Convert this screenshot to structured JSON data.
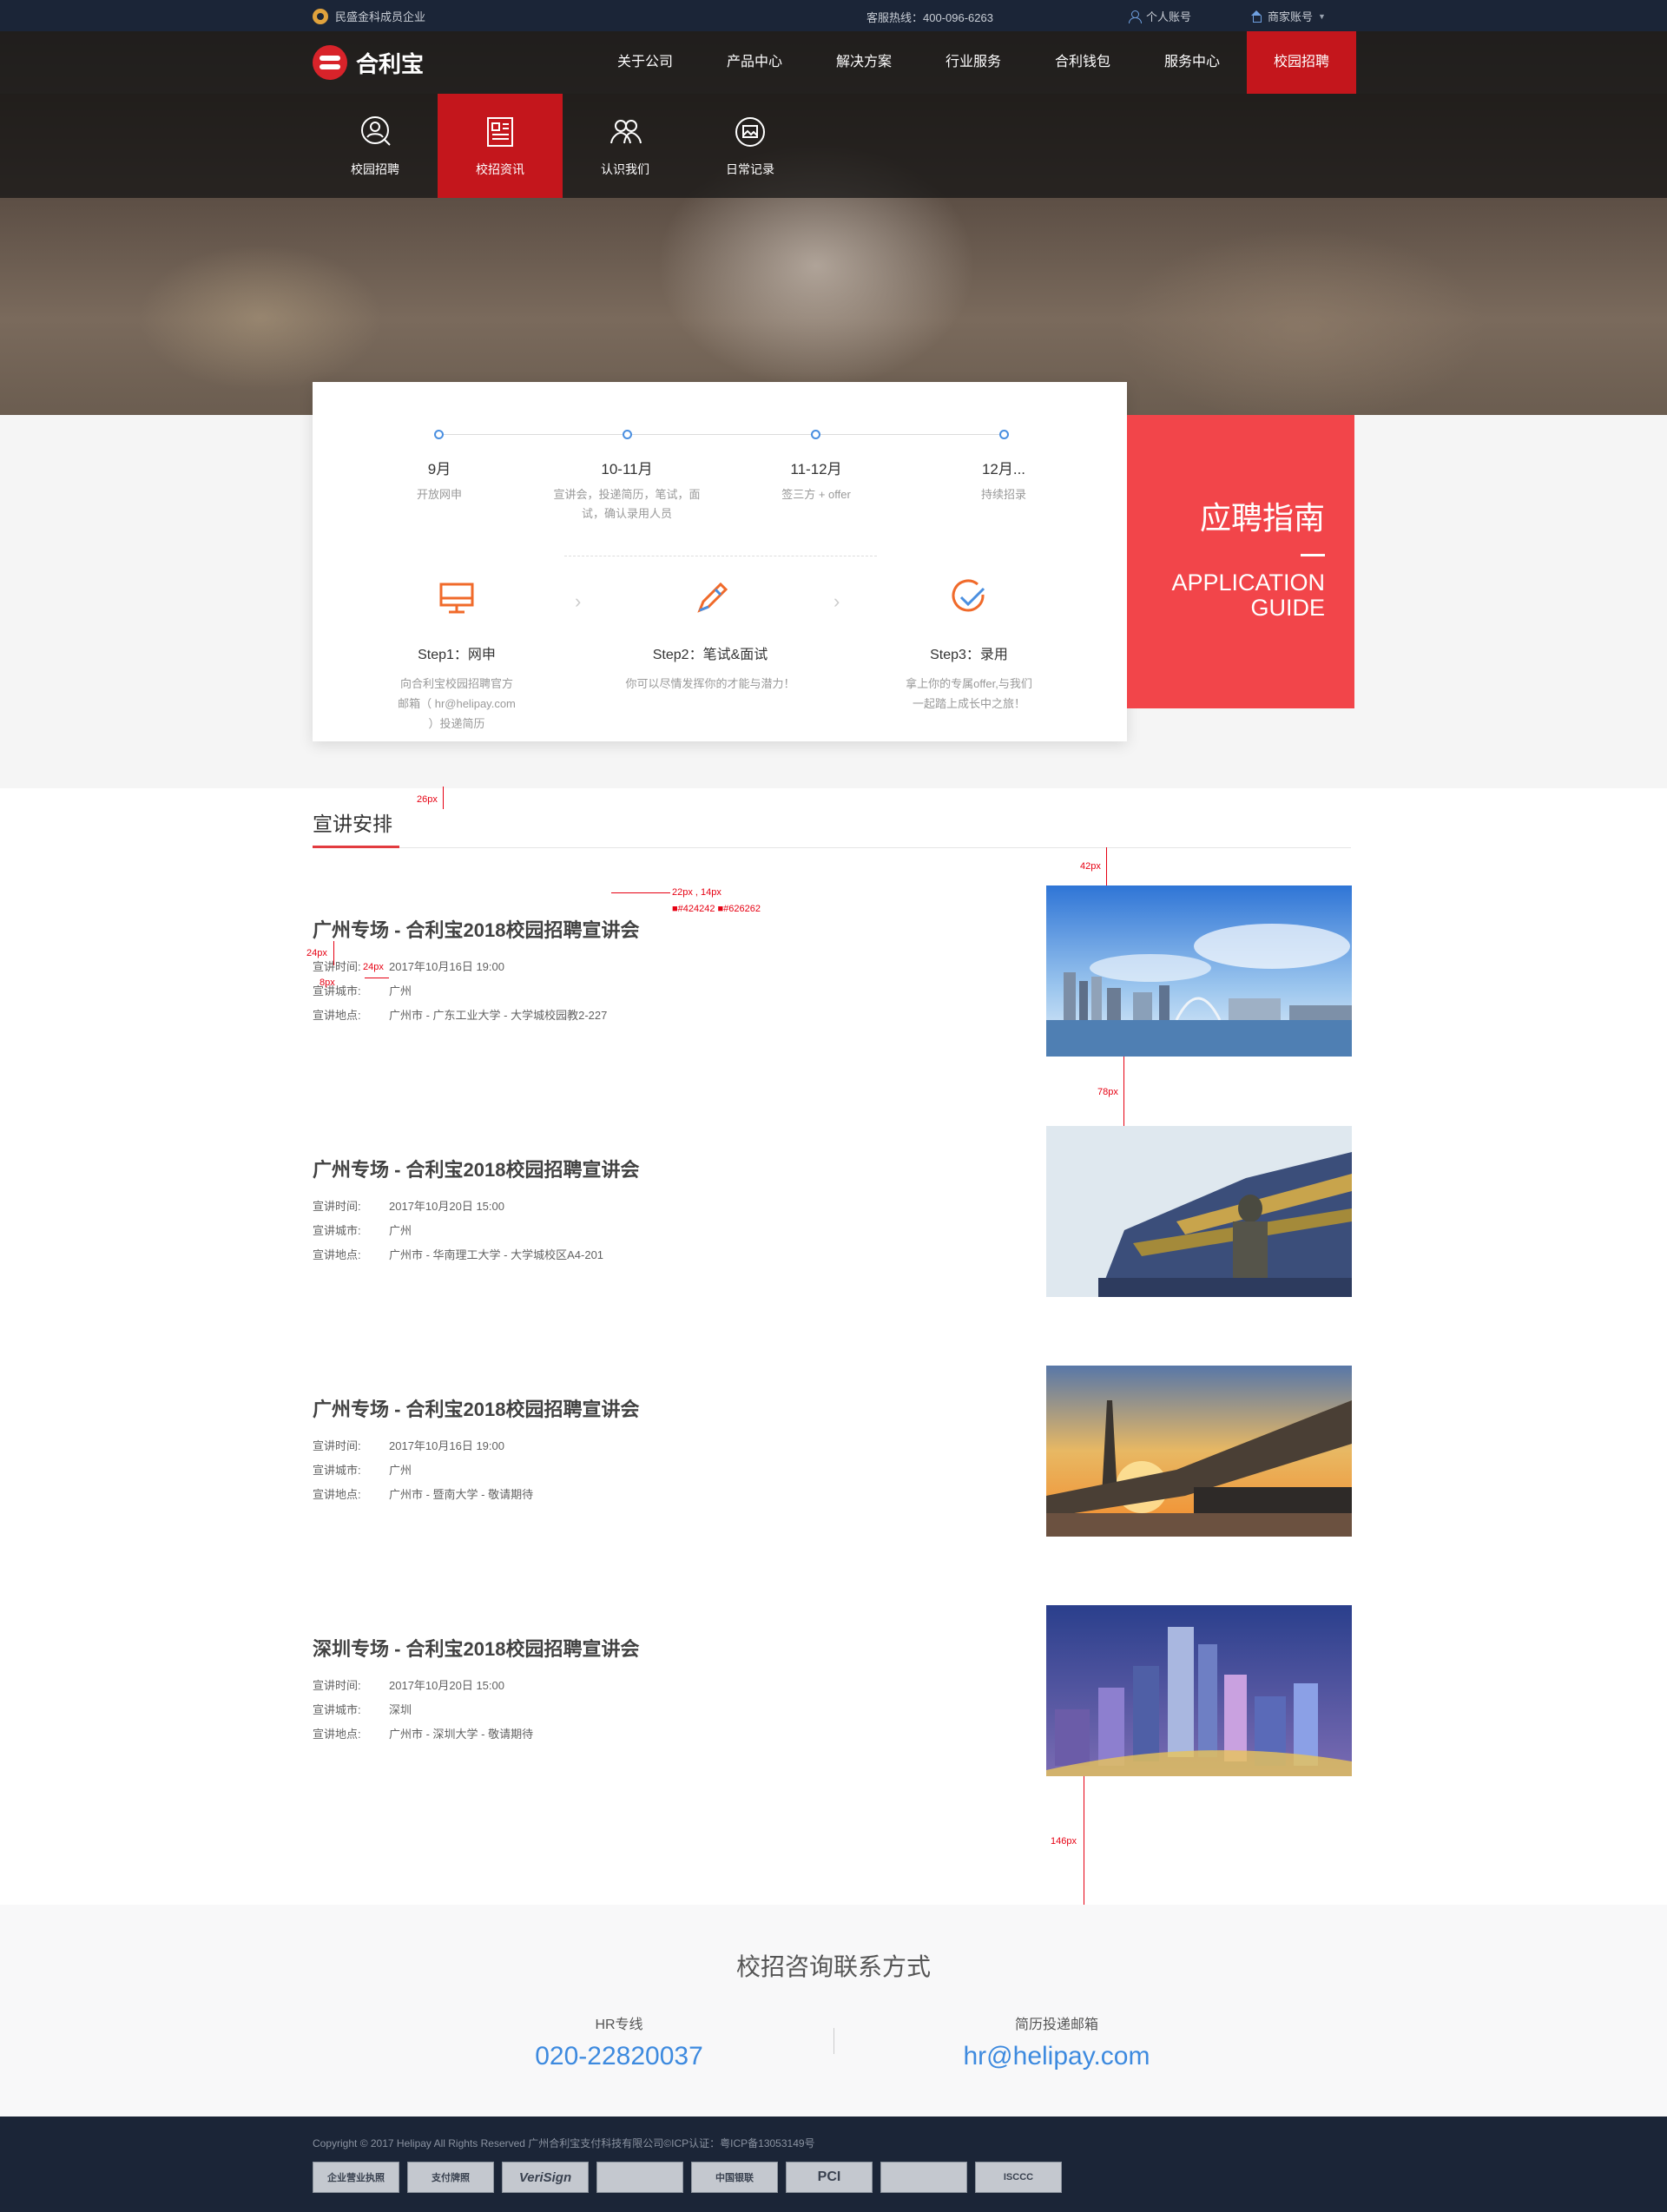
{
  "topbar": {
    "badge": "民盛金科成员企业",
    "hotline": "客服热线：400-096-6263",
    "user": "个人账号",
    "merchant": "商家账号"
  },
  "header": {
    "brand": "合利宝",
    "nav": [
      "关于公司",
      "产品中心",
      "解决方案",
      "行业服务",
      "合利钱包",
      "服务中心",
      "校园招聘"
    ],
    "active_nav": "校园招聘"
  },
  "subnav": {
    "items": [
      {
        "label": "校园招聘",
        "icon": "search-person-icon"
      },
      {
        "label": "校招资讯",
        "icon": "news-icon"
      },
      {
        "label": "认识我们",
        "icon": "group-icon"
      },
      {
        "label": "日常记录",
        "icon": "photo-icon"
      }
    ],
    "active": "校招资讯"
  },
  "timeline": [
    {
      "month": "9月",
      "desc": "开放网申"
    },
    {
      "month": "10-11月",
      "desc": "宣讲会，投递简历，笔试，面试，确认录用人员"
    },
    {
      "month": "11-12月",
      "desc": "签三方 + offer"
    },
    {
      "month": "12月...",
      "desc": "持续招录"
    }
  ],
  "steps": [
    {
      "title": "Step1：网申",
      "desc": "向合利宝校园招聘官方邮箱（ hr@helipay.com ）投递简历",
      "icon": "monitor-icon"
    },
    {
      "title": "Step2：笔试&面试",
      "desc": "你可以尽情发挥你的才能与潜力！",
      "icon": "pencil-icon"
    },
    {
      "title": "Step3：录用",
      "desc": "拿上你的专属offer,与我们一起踏上成长中之旅！",
      "icon": "check-circle-icon"
    }
  ],
  "guide": {
    "cn": "应聘指南",
    "en1": "APPLICATION",
    "en2": "GUIDE"
  },
  "section_title": "宣讲安排",
  "labels": {
    "time": "宣讲时间:",
    "city": "宣讲城市:",
    "place": "宣讲地点:"
  },
  "sessions": [
    {
      "title": "广州专场 - 合利宝2018校园招聘宣讲会",
      "time": "2017年10月16日  19:00",
      "city": "广州",
      "place": "广州市 - 广东工业大学 - 大学城校园教2-227"
    },
    {
      "title": "广州专场 - 合利宝2018校园招聘宣讲会",
      "time": "2017年10月20日  15:00",
      "city": "广州",
      "place": "广州市 - 华南理工大学 - 大学城校区A4-201"
    },
    {
      "title": "广州专场 - 合利宝2018校园招聘宣讲会",
      "time": "2017年10月16日  19:00",
      "city": "广州",
      "place": "广州市 - 暨南大学 - 敬请期待"
    },
    {
      "title": "深圳专场 - 合利宝2018校园招聘宣讲会",
      "time": "2017年10月20日  15:00",
      "city": "深圳",
      "place": "广州市 - 深圳大学 - 敬请期待"
    }
  ],
  "annotations": {
    "a26": "26px",
    "a42": "42px",
    "a22": "22px , 14px",
    "colors": "■#424242 ■#626262",
    "a24a": "24px",
    "a24b": "24px",
    "a8": "8px",
    "a78": "78px",
    "a146": "146px",
    "a47": "47px",
    "bg": "□#f8f8f9",
    "a244": "244px"
  },
  "contact": {
    "title": "校招咨询联系方式",
    "hr_label": "HR专线",
    "hr_value": "020-22820037",
    "mail_label": "简历投递邮箱",
    "mail_value": "hr@helipay.com"
  },
  "footer": {
    "copyright": "Copyright © 2017 Helipay All Rights Reserved    广州合利宝支付科技有限公司©ICP认证：粤ICP备13053149号",
    "badges": [
      "企业营业执照",
      "支付牌照",
      "VeriSign",
      "",
      "中国银联",
      "PCI",
      "",
      "ISCCC"
    ]
  },
  "colors": {
    "brand_red": "#c4161c",
    "guide_red": "#f2454a",
    "link_blue": "#3d8adf",
    "dark_bg": "#1b2537"
  }
}
